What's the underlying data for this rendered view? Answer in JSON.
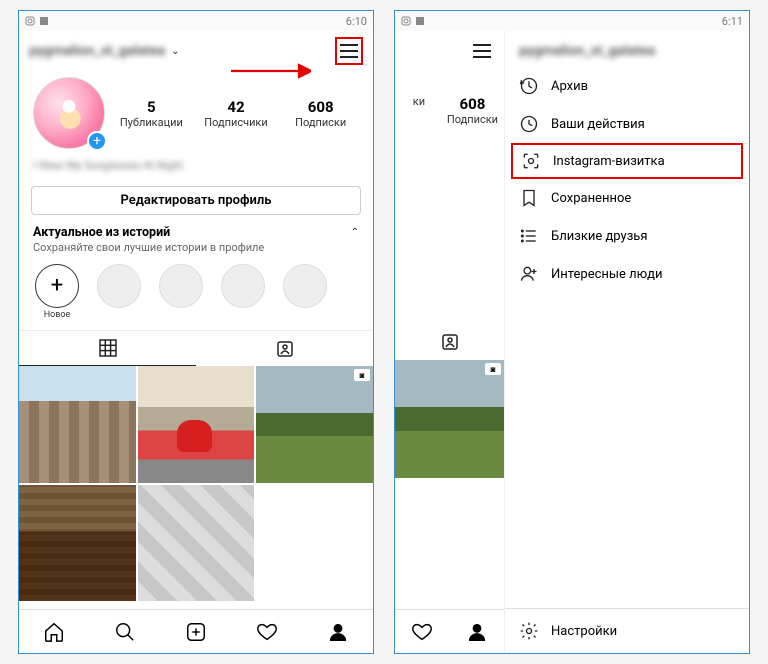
{
  "left": {
    "status": {
      "time": "6:10"
    },
    "username": "pygmalion_st_galatea",
    "stats": [
      {
        "n": "5",
        "l": "Публикации"
      },
      {
        "n": "42",
        "l": "Подписчики"
      },
      {
        "n": "608",
        "l": "Подписки"
      }
    ],
    "bio": "I Wear My Sunglasses At Night",
    "edit_label": "Редактировать профиль",
    "highlights": {
      "title": "Актуальное из историй",
      "sub": "Сохраняйте свои лучшие истории в профиле",
      "new_label": "Новое"
    }
  },
  "right": {
    "status": {
      "time": "6:11"
    },
    "username": "pygmalion_st_galatea",
    "stats": [
      {
        "n": "",
        "l": "ки"
      },
      {
        "n": "608",
        "l": "Подписки"
      }
    ],
    "menu": [
      {
        "icon": "clock-icon",
        "label": "Архив"
      },
      {
        "icon": "activity-icon",
        "label": "Ваши действия"
      },
      {
        "icon": "nametag-icon",
        "label": "Instagram-визитка",
        "highlight": true
      },
      {
        "icon": "bookmark-icon",
        "label": "Сохраненное"
      },
      {
        "icon": "list-icon",
        "label": "Близкие друзья"
      },
      {
        "icon": "user-plus-icon",
        "label": "Интересные люди"
      }
    ],
    "settings_label": "Настройки"
  }
}
